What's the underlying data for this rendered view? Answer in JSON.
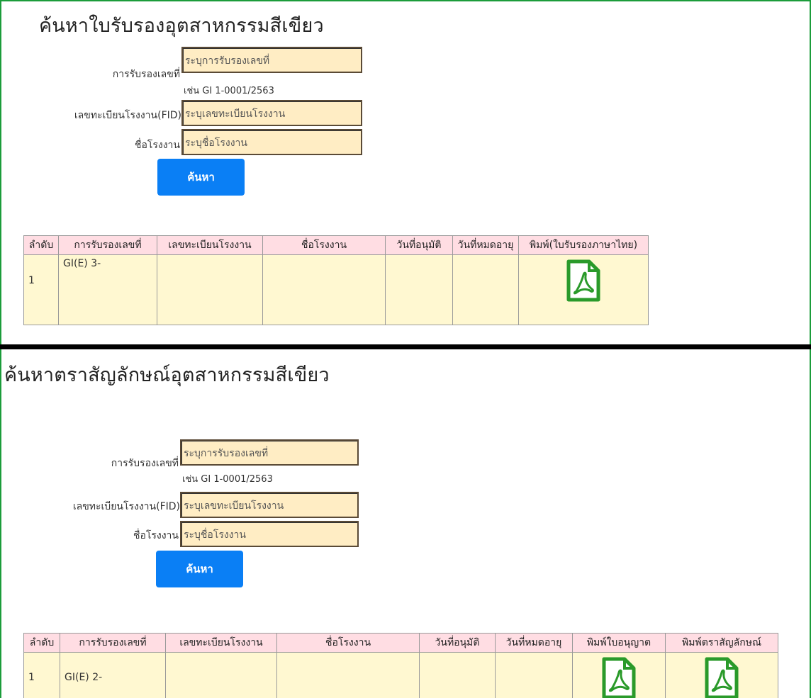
{
  "certificate_search": {
    "title": "ค้นหาใบรับรองอุตสาหกรรมสีเขียว",
    "fields": {
      "cert_no_label": "การรับรองเลขที่",
      "cert_no_placeholder": "ระบุการรับรองเลขที่",
      "cert_no_hint": "เช่น GI 1-0001/2563",
      "fid_label": "เลขทะเบียนโรงงาน(FID)",
      "fid_placeholder": "ระบุเลขทะเบียนโรงงาน",
      "factory_label": "ชื่อโรงงาน",
      "factory_placeholder": "ระบุชื่อโรงงาน"
    },
    "search_button": "ค้นหา",
    "table": {
      "headers": [
        "ลำดับ",
        "การรับรองเลขที่",
        "เลขทะเบียนโรงงาน",
        "ชื่อโรงงาน",
        "วันที่อนุมัติ",
        "วันที่หมดอายุ",
        "พิมพ์(ใบรับรองภาษาไทย)"
      ],
      "rows": [
        {
          "no": "1",
          "cert": "GI(E) 3-",
          "fid": "",
          "factory": "",
          "approved": "",
          "expires": "",
          "print_icon": "pdf-icon"
        }
      ]
    }
  },
  "logo_search": {
    "title": "ค้นหาตราสัญลักษณ์อุตสาหกรรมสีเขียว",
    "fields": {
      "cert_no_label": "การรับรองเลขที่",
      "cert_no_placeholder": "ระบุการรับรองเลขที่",
      "cert_no_hint": "เช่น GI 1-0001/2563",
      "fid_label": "เลขทะเบียนโรงงาน(FID)",
      "fid_placeholder": "ระบุเลขทะเบียนโรงงาน",
      "factory_label": "ชื่อโรงงาน",
      "factory_placeholder": "ระบุชื่อโรงงาน"
    },
    "search_button": "ค้นหา",
    "table": {
      "headers": [
        "ลำดับ",
        "การรับรองเลขที่",
        "เลขทะเบียนโรงงาน",
        "ชื่อโรงงาน",
        "วันที่อนุมัติ",
        "วันที่หมดอายุ",
        "พิมพ์ใบอนุญาต",
        "พิมพ์ตราสัญลักษณ์"
      ],
      "rows": [
        {
          "no": "1",
          "cert": "GI(E) 2-",
          "fid": "",
          "factory": "",
          "approved": "",
          "expires": "",
          "print_icon": "pdf-icon"
        }
      ]
    }
  },
  "colors": {
    "border_green": "#1b9c3a",
    "button_blue": "#0a7ff5",
    "input_bg": "#ffedc4",
    "table_header_bg": "#ffdde3",
    "table_row_bg": "#fff8d1",
    "pdf_icon_green": "#2a9a2a"
  }
}
